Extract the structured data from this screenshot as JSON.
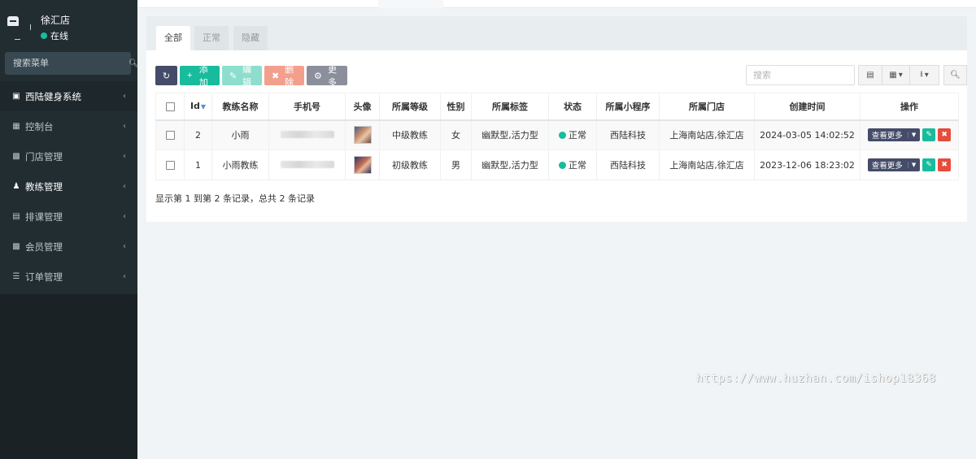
{
  "user": {
    "name": "徐汇店",
    "status": "在线"
  },
  "sidebar": {
    "search_placeholder": "搜索菜单",
    "items": [
      {
        "label": "西陆健身系统",
        "icon": "store-icon"
      },
      {
        "label": "控制台",
        "icon": "dashboard-icon"
      },
      {
        "label": "门店管理",
        "icon": "shop-icon"
      },
      {
        "label": "教练管理",
        "icon": "coach-icon"
      },
      {
        "label": "排课管理",
        "icon": "calendar-icon"
      },
      {
        "label": "会员管理",
        "icon": "member-card-icon"
      },
      {
        "label": "订单管理",
        "icon": "database-icon"
      }
    ]
  },
  "tabs": [
    "全部",
    "正常",
    "隐藏"
  ],
  "toolbar": {
    "add": "添加",
    "edit": "编辑",
    "delete": "删除",
    "more": "更多",
    "search_placeholder": "搜索"
  },
  "table": {
    "headers": [
      "Id",
      "教练名称",
      "手机号",
      "头像",
      "所属等级",
      "性别",
      "所属标签",
      "状态",
      "所属小程序",
      "所属门店",
      "创建时间",
      "操作"
    ],
    "rows": [
      {
        "id": "2",
        "name": "小雨",
        "level": "中级教练",
        "gender": "女",
        "tags": "幽默型,活力型",
        "status": "正常",
        "app": "西陆科技",
        "store": "上海南站店,徐汇店",
        "created": "2024-03-05 14:02:52"
      },
      {
        "id": "1",
        "name": "小雨教练",
        "level": "初级教练",
        "gender": "男",
        "tags": "幽默型,活力型",
        "status": "正常",
        "app": "西陆科技",
        "store": "上海南站店,徐汇店",
        "created": "2023-12-06 18:23:02"
      }
    ],
    "view_more": "查看更多"
  },
  "pager": {
    "info": "显示第 1 到第 2 条记录，总共 2 条记录"
  },
  "watermark": "https://www.huzhan.com/ishop18368",
  "colors": {
    "sidebar": "#222d32",
    "accent": "#18bc9c",
    "primary": "#444c69",
    "danger": "#e74c3c"
  }
}
